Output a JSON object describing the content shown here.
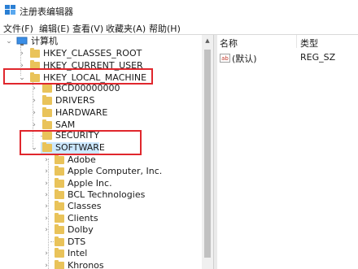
{
  "window": {
    "title": "注册表编辑器"
  },
  "menu": [
    {
      "label": "文件(F)"
    },
    {
      "label": "编辑(E)"
    },
    {
      "label": "查看(V)"
    },
    {
      "label": "收藏夹(A)"
    },
    {
      "label": "帮助(H)"
    }
  ],
  "tree": {
    "root": "计算机",
    "hives": [
      "HKEY_CLASSES_ROOT",
      "HKEY_CURRENT_USER",
      "HKEY_LOCAL_MACHINE"
    ],
    "hklm_children": [
      "BCD00000000",
      "DRIVERS",
      "HARDWARE",
      "SAM",
      "SECURITY",
      "SOFTWARE"
    ],
    "software_children": [
      "Adobe",
      "Apple Computer, Inc.",
      "Apple Inc.",
      "BCL Technologies",
      "Classes",
      "Clients",
      "Dolby",
      "DTS",
      "Intel",
      "Khronos"
    ]
  },
  "values": {
    "col_name": "名称",
    "col_type": "类型",
    "rows": [
      {
        "name": "(默认)",
        "type": "REG_SZ",
        "icon": "ab"
      }
    ]
  },
  "colors": {
    "highlight_box": "#e0272d",
    "selection": "#cce8ff",
    "folder": "#e9c35a"
  }
}
